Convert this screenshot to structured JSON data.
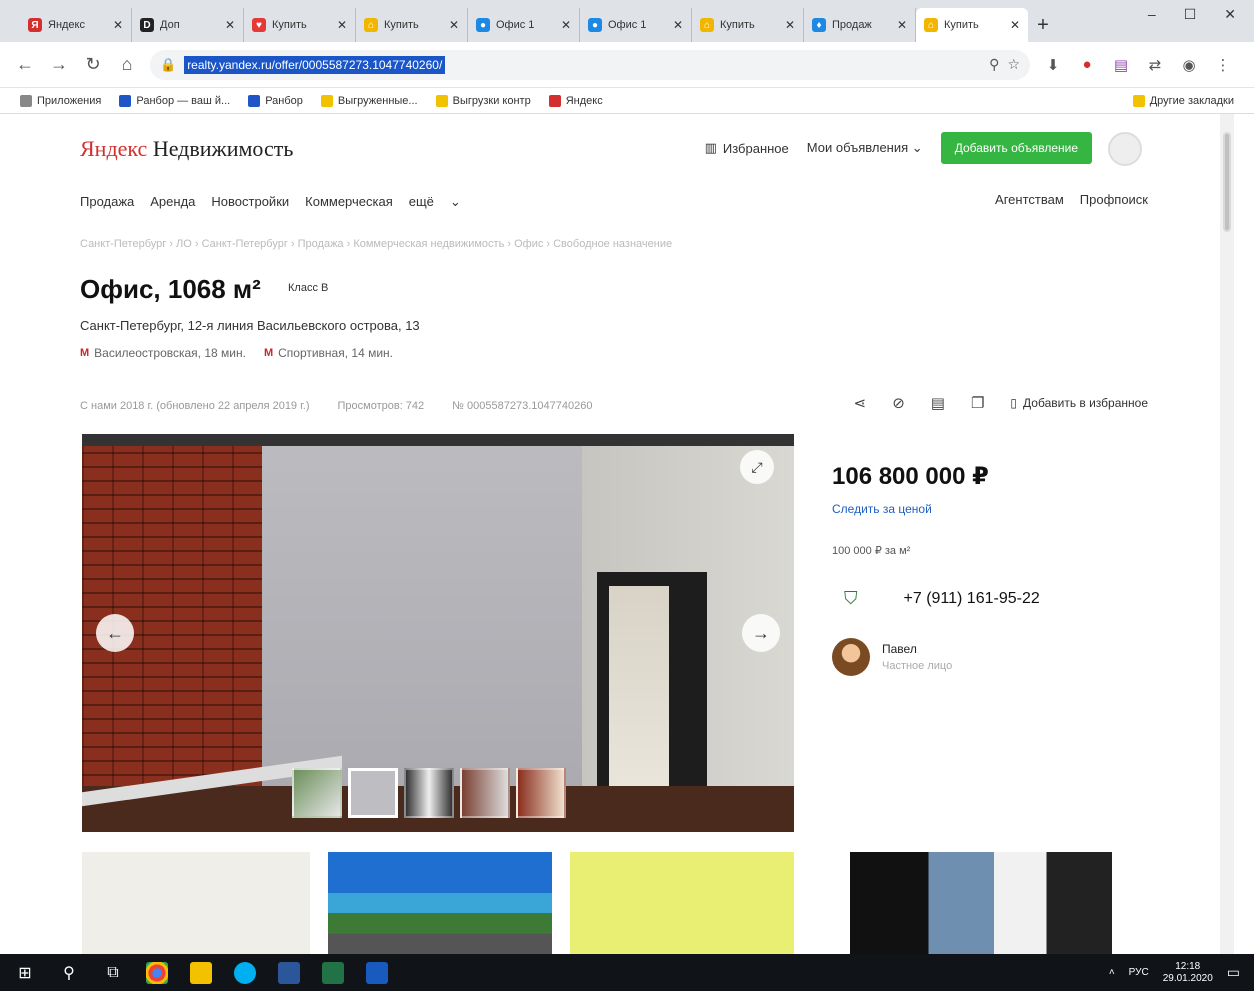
{
  "browser": {
    "tabs": [
      {
        "label": "Яндекс",
        "fav_text": "Я",
        "color": "#d32f2f",
        "active": false
      },
      {
        "label": "Доп",
        "fav_text": "D",
        "color": "#222222",
        "active": false
      },
      {
        "label": "Купить",
        "fav_text": "♥",
        "color": "#e53935",
        "active": false
      },
      {
        "label": "Купить",
        "fav_text": "⌂",
        "color": "#f2b600",
        "active": false
      },
      {
        "label": "Офис 1",
        "fav_text": "●",
        "color": "#1e88e5",
        "active": false
      },
      {
        "label": "Офис 1",
        "fav_text": "●",
        "color": "#1e88e5",
        "active": false
      },
      {
        "label": "Купить",
        "fav_text": "⌂",
        "color": "#f2b600",
        "active": false
      },
      {
        "label": "Продаж",
        "fav_text": "♦",
        "color": "#1e88e5",
        "active": false
      },
      {
        "label": "Купить",
        "fav_text": "⌂",
        "color": "#f2b600",
        "active": true
      }
    ],
    "url": "realty.yandex.ru/offer/0005587273.1047740260/",
    "bookmarks": [
      {
        "label": "Приложения",
        "color": "#888888"
      },
      {
        "label": "Ранбор — ваш й...",
        "color": "#1e56c8"
      },
      {
        "label": "Ранбор",
        "color": "#1e56c8"
      },
      {
        "label": "Выгруженные...",
        "color": "#f2c200"
      },
      {
        "label": "Выгрузки контр",
        "color": "#f2c200"
      },
      {
        "label": "Яндекс",
        "color": "#d32f2f"
      }
    ],
    "bookmarks_other": "Другие закладки"
  },
  "site": {
    "logo_ya": "Яндекс",
    "logo_rest": "Недвижимость",
    "favorites_link": "Избранное",
    "my_listings": "Мои объявления",
    "add_listing_button": "Добавить объявление",
    "nav": [
      "Продажа",
      "Аренда",
      "Новостройки",
      "Коммерческая",
      "ещё"
    ],
    "nav_right": [
      "Агентствам",
      "Профпоиск"
    ]
  },
  "listing": {
    "breadcrumbs": "Санкт-Петербург › ЛО › Санкт-Петербург › Продажа › Коммерческая недвижимость › Офис › Свободное назначение",
    "title": "Офис, 1068 м²",
    "class": "Класс B",
    "address": "Санкт-Петербург, 12-я линия Васильевского острова, 13",
    "metro": [
      {
        "name": "Василеостровская, 18 мин.",
        "icon": "metro-icon"
      },
      {
        "name": "Спортивная, 14 мин.",
        "icon": "metro-icon"
      }
    ],
    "meta": [
      "С нами 2018 г. (обновлено 22 апреля 2019 г.)",
      "Просмотров: 742",
      "№ 0005587273.1047740260"
    ],
    "add_to_favorites": "Добавить в избранное",
    "price": "106 800 000 ₽",
    "track_price": "Следить за ценой",
    "price_per_m2": "100 000 ₽ за м²",
    "phone": "+7 (911) 161-95-22",
    "seller_name": "Павел",
    "seller_role": "Частное лицо",
    "photo_count_thumbs": 5
  },
  "taskbar": {
    "lang": "РУС",
    "time": "12:18",
    "date": "29.01.2020"
  }
}
